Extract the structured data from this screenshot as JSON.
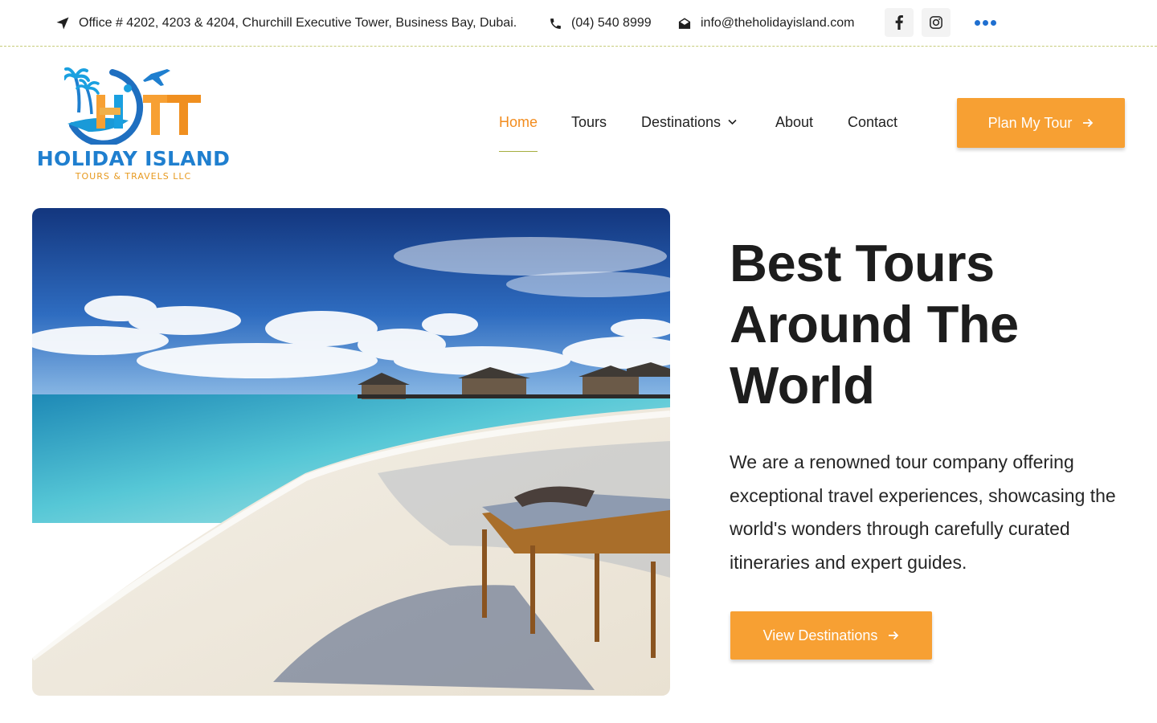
{
  "topbar": {
    "address": "Office # 4202, 4203 & 4204, Churchill Executive Tower, Business Bay, Dubai.",
    "phone": "(04) 540 8999",
    "email": "info@theholidayisland.com",
    "icons": {
      "address": "location-arrow-icon",
      "phone": "phone-icon",
      "email": "envelope-open-icon",
      "facebook": "facebook-icon",
      "instagram": "instagram-icon",
      "more": "more-dots-icon"
    }
  },
  "logo": {
    "title": "HOLIDAY ISLAND",
    "subtitle": "TOURS & TRAVELS LLC"
  },
  "nav": {
    "items": [
      {
        "label": "Home",
        "active": true
      },
      {
        "label": "Tours"
      },
      {
        "label": "Destinations",
        "has_dropdown": true
      },
      {
        "label": "About"
      },
      {
        "label": "Contact"
      }
    ],
    "cta": "Plan My Tour"
  },
  "hero": {
    "title_line1": "Best Tours",
    "title_line2": "Around The",
    "title_line3": "World",
    "description": "We are a renowned tour company offering exceptional travel experiences, showcasing the world's wonders through carefully curated itineraries and expert guides.",
    "cta": "View Destinations"
  },
  "colors": {
    "accent_orange": "#f7a033",
    "active_nav": "#f28c1e",
    "brand_blue": "#1f7fcf",
    "text_dark": "#1d1d1d"
  }
}
